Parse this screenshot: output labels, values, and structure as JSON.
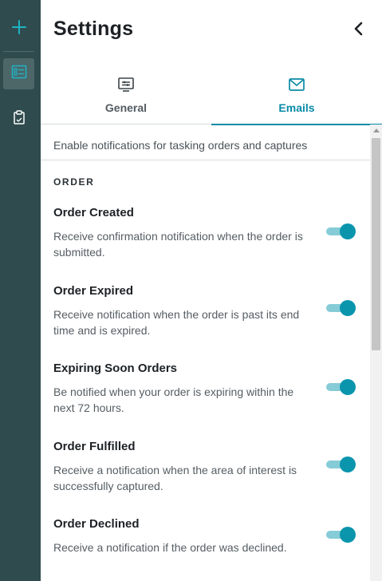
{
  "rail": {
    "items": [
      {
        "icon": "plus-icon"
      },
      {
        "icon": "task-list-icon",
        "active": true
      },
      {
        "icon": "clipboard-icon"
      }
    ]
  },
  "header": {
    "title": "Settings",
    "close_icon": "chevron-left-icon"
  },
  "tabs": [
    {
      "label": "General",
      "icon": "settings-panel-icon",
      "active": false
    },
    {
      "label": "Emails",
      "icon": "mail-icon",
      "active": true
    }
  ],
  "content": {
    "intro": "Enable notifications for tasking orders and captures",
    "section_label": "ORDER",
    "items": [
      {
        "title": "Order Created",
        "description": "Receive confirmation notification when the order is submitted.",
        "enabled": true
      },
      {
        "title": "Order Expired",
        "description": "Receive notification when the order is past its end time and is expired.",
        "enabled": true
      },
      {
        "title": "Expiring Soon Orders",
        "description": "Be notified when your order is expiring within the next 72 hours.",
        "enabled": true
      },
      {
        "title": "Order Fulfilled",
        "description": "Receive a notification when the area of interest is successfully captured.",
        "enabled": true
      },
      {
        "title": "Order Declined",
        "description": "Receive a notification if the order was declined.",
        "enabled": true
      }
    ]
  },
  "colors": {
    "rail_bg": "#2f4b4d",
    "accent": "#0a8aa6",
    "toggle_track": "#86ccd7",
    "toggle_knob": "#0a95ad"
  }
}
